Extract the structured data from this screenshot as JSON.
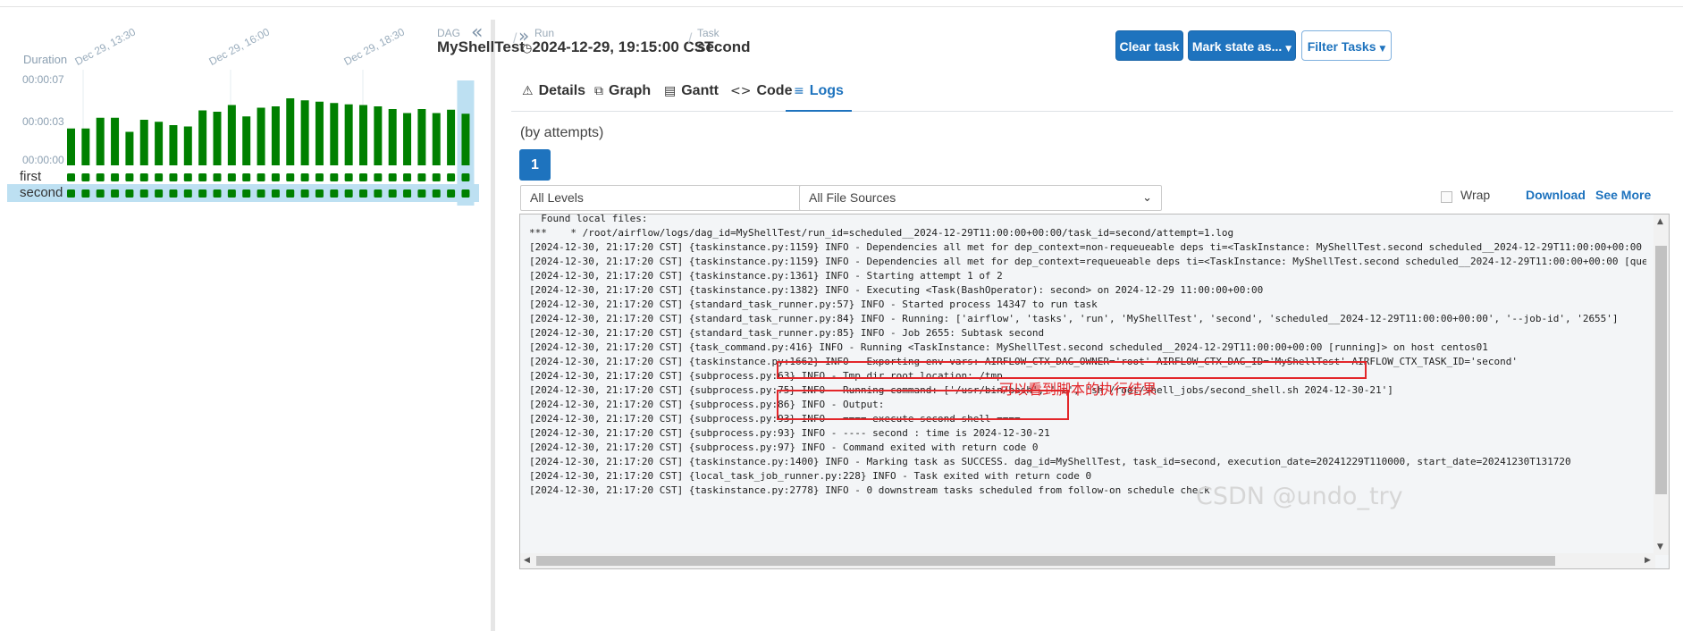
{
  "grid": {
    "collapse_icon": "double-chevron-left-icon",
    "y_title": "Duration",
    "y_ticks": [
      "00:00:07",
      "00:00:03",
      "00:00:00"
    ],
    "date_labels": [
      "Dec 29, 13:30",
      "Dec 29, 16:00",
      "Dec 29, 18:30"
    ],
    "run_duration_fractions": [
      0.55,
      0.55,
      0.71,
      0.71,
      0.5,
      0.68,
      0.65,
      0.6,
      0.58,
      0.82,
      0.8,
      0.9,
      0.73,
      0.86,
      0.88,
      1.0,
      0.97,
      0.95,
      0.93,
      0.91,
      0.9,
      0.88,
      0.84,
      0.78,
      0.84,
      0.78,
      0.83,
      0.77
    ],
    "selected_run_index": 27,
    "success_color": "#008000",
    "selected_color": "#bde0f2",
    "rows": [
      {
        "label": "first",
        "selected": false
      },
      {
        "label": "second",
        "selected": true
      }
    ]
  },
  "breadcrumb": {
    "dag_key": "DAG",
    "dag": "MyShellTest",
    "run_key": "Run",
    "run": "2024-12-29, 19:15:00 CST",
    "task_key": "Task",
    "task": "second",
    "separator": "/"
  },
  "actions": {
    "clear_task": "Clear task",
    "mark_state": "Mark state as...",
    "filter_tasks": "Filter Tasks"
  },
  "tabs": [
    {
      "label": "Details",
      "icon": "warning-triangle-icon"
    },
    {
      "label": "Graph",
      "icon": "graph-nodes-icon"
    },
    {
      "label": "Gantt",
      "icon": "gantt-chart-icon"
    },
    {
      "label": "Code",
      "icon": "code-brackets-icon"
    },
    {
      "label": "Logs",
      "icon": "list-lines-icon",
      "active": true
    }
  ],
  "logs": {
    "attempts_label": "(by attempts)",
    "attempt_number": "1",
    "level_select": "All Levels",
    "source_select": "All File Sources",
    "wrap_label": "Wrap",
    "download_label": "Download",
    "see_more_label": "See More",
    "text": "  Found local files:\n***    * /root/airflow/logs/dag_id=MyShellTest/run_id=scheduled__2024-12-29T11:00:00+00:00/task_id=second/attempt=1.log\n[2024-12-30, 21:17:20 CST] {taskinstance.py:1159} INFO - Dependencies all met for dep_context=non-requeueable deps ti=<TaskInstance: MyShellTest.second scheduled__2024-12-29T11:00:00+00:00 [queued]>\n[2024-12-30, 21:17:20 CST] {taskinstance.py:1159} INFO - Dependencies all met for dep_context=requeueable deps ti=<TaskInstance: MyShellTest.second scheduled__2024-12-29T11:00:00+00:00 [queued]>\n[2024-12-30, 21:17:20 CST] {taskinstance.py:1361} INFO - Starting attempt 1 of 2\n[2024-12-30, 21:17:20 CST] {taskinstance.py:1382} INFO - Executing <Task(BashOperator): second> on 2024-12-29 11:00:00+00:00\n[2024-12-30, 21:17:20 CST] {standard_task_runner.py:57} INFO - Started process 14347 to run task\n[2024-12-30, 21:17:20 CST] {standard_task_runner.py:84} INFO - Running: ['airflow', 'tasks', 'run', 'MyShellTest', 'second', 'scheduled__2024-12-29T11:00:00+00:00', '--job-id', '2655']\n[2024-12-30, 21:17:20 CST] {standard_task_runner.py:85} INFO - Job 2655: Subtask second\n[2024-12-30, 21:17:20 CST] {task_command.py:416} INFO - Running <TaskInstance: MyShellTest.second scheduled__2024-12-29T11:00:00+00:00 [running]> on host centos01\n[2024-12-30, 21:17:20 CST] {taskinstance.py:1662} INFO - Exporting env vars: AIRFLOW_CTX_DAG_OWNER='root' AIRFLOW_CTX_DAG_ID='MyShellTest' AIRFLOW_CTX_TASK_ID='second'\n[2024-12-30, 21:17:20 CST] {subprocess.py:63} INFO - Tmp dir root location: /tmp\n[2024-12-30, 21:17:20 CST] {subprocess.py:75} INFO - Running command: ['/usr/bin/bash', '-c', 'sh /root/shell_jobs/second_shell.sh 2024-12-30-21']\n[2024-12-30, 21:17:20 CST] {subprocess.py:86} INFO - Output:\n[2024-12-30, 21:17:20 CST] {subprocess.py:93} INFO - ==== execute second shell ====\n[2024-12-30, 21:17:20 CST] {subprocess.py:93} INFO - ---- second : time is 2024-12-30-21\n[2024-12-30, 21:17:20 CST] {subprocess.py:97} INFO - Command exited with return code 0\n[2024-12-30, 21:17:20 CST] {taskinstance.py:1400} INFO - Marking task as SUCCESS. dag_id=MyShellTest, task_id=second, execution_date=20241229T110000, start_date=20241230T131720\n[2024-12-30, 21:17:20 CST] {local_task_job_runner.py:228} INFO - Task exited with return code 0\n[2024-12-30, 21:17:20 CST] {taskinstance.py:2778} INFO - 0 downstream tasks scheduled from follow-on schedule check"
  },
  "annotation": "可以看到脚本的执行结果",
  "watermark": "CSDN @undo_try"
}
